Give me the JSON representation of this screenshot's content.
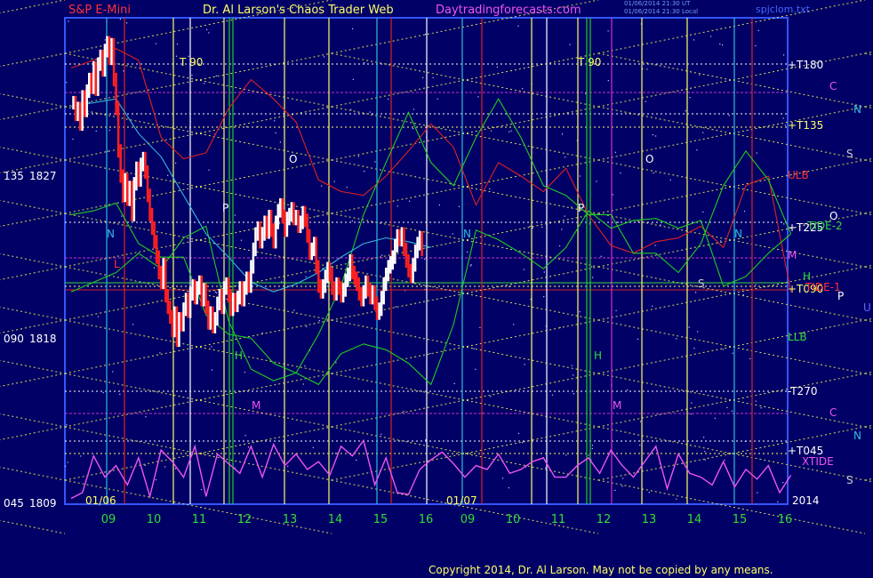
{
  "header": {
    "symbol": "S&P E-Mini",
    "author": "Dr. Al Larson's Chaos Trader Web",
    "site": "Daytradingforecasts.com",
    "stamp_line1": "01/06/2014 21:30 UT",
    "stamp_line2": "01/06/2014 21:30 Local",
    "file": "spjclom.txt"
  },
  "footer": {
    "copyright": "Copyright 2014, Dr. Al Larson. May not be copied by any means."
  },
  "colors": {
    "background": "#000066",
    "border": "#3355ff",
    "price_bar": "#ffffff",
    "price_down": "#ff2020",
    "red_line": "#dd2222",
    "green_line": "#22cc22",
    "cyan_line": "#33bbdd",
    "magenta_line": "#ee55ee",
    "yellow_dotted": "#dddd55"
  },
  "labels": {
    "t90_a": "T  90",
    "t90_b": "T  90",
    "date_a": "01/06",
    "date_b": "01/07",
    "year": "2014",
    "O_a": "O",
    "O_b": "O",
    "P_a": "P",
    "P_b": "P",
    "N_a": "N",
    "N_b": "N",
    "H_a": "H",
    "H_b": "H",
    "M_a": "M",
    "M_b": "M",
    "S_mid": "S",
    "L_mid": "L"
  },
  "right_labels": [
    {
      "text": "+T180",
      "color": "#ffffff"
    },
    {
      "text": "+T135",
      "color": "#ffff66"
    },
    {
      "text": "ULB",
      "color": "#ff3333"
    },
    {
      "text": "+T225",
      "color": "#ffffff"
    },
    {
      "text": "TIDE-2",
      "color": "#33dd33"
    },
    {
      "text": "M",
      "color": "#ee55ee"
    },
    {
      "text": "H",
      "color": "#33dd33"
    },
    {
      "text": "+T090",
      "color": "#ffff66"
    },
    {
      "text": "TIDE-1",
      "color": "#ff3333"
    },
    {
      "text": "LLB",
      "color": "#33dd33"
    },
    {
      "text": "-T270",
      "color": "#ffffff"
    },
    {
      "text": "+T045",
      "color": "#ffffff"
    },
    {
      "text": "XTIDE",
      "color": "#ee55ee"
    }
  ],
  "planet_labels": [
    {
      "text": "C",
      "color": "#ee55ee"
    },
    {
      "text": "N",
      "color": "#33bbdd"
    },
    {
      "text": "S",
      "color": "#cccccc"
    },
    {
      "text": "O",
      "color": "#ffffff"
    },
    {
      "text": "P",
      "color": "#ffffff"
    },
    {
      "text": "U",
      "color": "#6666ff"
    },
    {
      "text": "C",
      "color": "#ee55ee"
    },
    {
      "text": "N",
      "color": "#33bbdd"
    },
    {
      "text": "S",
      "color": "#cccccc"
    }
  ],
  "chart_data": {
    "type": "line",
    "title": "S&P E-Mini",
    "x_ticks": [
      "09",
      "10",
      "11",
      "12",
      "13",
      "14",
      "15",
      "16",
      "09",
      "10",
      "11",
      "12",
      "13",
      "14",
      "15",
      "16"
    ],
    "y_ticks": [
      {
        "angle": "135",
        "price": "1827"
      },
      {
        "angle": "090",
        "price": "1818"
      },
      {
        "angle": "045",
        "price": "1809"
      }
    ],
    "ylim": [
      1809,
      1834.2
    ],
    "price_series": {
      "name": "S&P E-Mini",
      "x": [
        0.05,
        0.1,
        0.15,
        0.2,
        0.25,
        0.3,
        0.35,
        0.4,
        0.45,
        0.5,
        0.55,
        0.6,
        0.65,
        0.7,
        0.75,
        0.8,
        0.85,
        0.9,
        0.95,
        1.0,
        1.05,
        1.1,
        1.15,
        1.2,
        1.25,
        1.3,
        1.35,
        1.4,
        1.45,
        1.5,
        1.55,
        1.6,
        1.65,
        1.7,
        1.75,
        1.8,
        1.85,
        1.9,
        1.95,
        2.0,
        2.05,
        2.1,
        2.15,
        2.2,
        2.25,
        2.3,
        2.35,
        2.4,
        2.45,
        2.5,
        2.55,
        2.6,
        2.65,
        2.7,
        2.75,
        2.8,
        2.85,
        2.9,
        2.95,
        3.0,
        3.05,
        3.1,
        3.15,
        3.2,
        3.25,
        3.3,
        3.35,
        3.4,
        3.45,
        3.5,
        3.55,
        3.6,
        3.65,
        3.7,
        3.75,
        3.8,
        3.85,
        3.9,
        3.95,
        4.0,
        4.05,
        4.1,
        4.15,
        4.2,
        4.25,
        4.3,
        4.35,
        4.4,
        4.45,
        4.5,
        4.55,
        4.6,
        4.65,
        4.7,
        4.75,
        4.8,
        4.85,
        4.9,
        4.95,
        5.0,
        5.05,
        5.1,
        5.15,
        5.2,
        5.25,
        5.3,
        5.35,
        5.4,
        5.45,
        5.5,
        5.55,
        5.6,
        5.65,
        5.7,
        5.75,
        5.8,
        5.85,
        5.9,
        5.95,
        6.0,
        6.05,
        6.1,
        6.15,
        6.2,
        6.25,
        6.3,
        6.35,
        6.4,
        6.45,
        6.5,
        6.55,
        6.6,
        6.65,
        6.7,
        6.75,
        6.8,
        6.85,
        6.9,
        6.95,
        7.0,
        7.05,
        7.1,
        7.15,
        7.2,
        7.25,
        7.3,
        7.35,
        7.4,
        7.45,
        7.5,
        7.55,
        7.6,
        7.65,
        7.7,
        7.75,
        7.8,
        7.85,
        7.9
      ],
      "y": [
        1829.8,
        1829.2,
        1829.5,
        1828.7,
        1830.1,
        1829.4,
        1830.4,
        1831.0,
        1830.6,
        1831.6,
        1830.5,
        1831.8,
        1832.2,
        1831.5,
        1832.5,
        1832.9,
        1832.1,
        1832.8,
        1831.0,
        1829.5,
        1827.3,
        1826.0,
        1825.0,
        1825.8,
        1824.8,
        1825.4,
        1824.0,
        1825.6,
        1826.4,
        1825.8,
        1826.6,
        1826.9,
        1826.2,
        1825.0,
        1824.0,
        1823.3,
        1822.6,
        1821.8,
        1821.0,
        1820.5,
        1821.4,
        1819.8,
        1819.2,
        1818.7,
        1818.0,
        1818.9,
        1817.5,
        1818.6,
        1818.3,
        1819.1,
        1819.6,
        1819.0,
        1819.9,
        1820.3,
        1819.7,
        1820.2,
        1820.5,
        1819.6,
        1820.1,
        1819.2,
        1818.4,
        1818.9,
        1818.2,
        1818.6,
        1819.4,
        1819.8,
        1819.2,
        1820.2,
        1820.4,
        1819.8,
        1819.1,
        1819.6,
        1819.3,
        1819.7,
        1820.2,
        1819.6,
        1820.2,
        1820.7,
        1820.3,
        1821.3,
        1822.2,
        1823.0,
        1823.3,
        1822.6,
        1823.0,
        1823.6,
        1823.1,
        1823.9,
        1823.2,
        1822.6,
        1823.6,
        1824.2,
        1824.5,
        1823.9,
        1823.2,
        1823.8,
        1824.0,
        1824.3,
        1823.8,
        1823.9,
        1823.4,
        1823.6,
        1824.1,
        1823.7,
        1822.9,
        1822.0,
        1822.2,
        1822.5,
        1821.3,
        1820.3,
        1820.0,
        1820.3,
        1820.8,
        1821.2,
        1820.9,
        1820.2,
        1819.9,
        1820.4,
        1820.2,
        1819.8,
        1820.1,
        1820.6,
        1820.9,
        1821.6,
        1821.0,
        1820.7,
        1820.4,
        1819.9,
        1819.6,
        1820.0,
        1820.5,
        1820.1,
        1819.7,
        1820.0,
        1819.4,
        1818.9,
        1819.1,
        1819.7,
        1820.4,
        1820.9,
        1821.3,
        1821.5,
        1821.8,
        1822.4,
        1822.9,
        1822.7,
        1823.0,
        1822.2,
        1821.6,
        1821.1,
        1820.8,
        1821.4,
        1822.1,
        1822.5,
        1822.8,
        1822.2
      ],
      "note": "data"
    },
    "series": [
      {
        "name": "ULB",
        "color": "#dd2222",
        "x": [
          0,
          0.5,
          1,
          1.5,
          2,
          2.5,
          3,
          3.5,
          4,
          4.5,
          5,
          5.5,
          6,
          6.5,
          7,
          7.5,
          8,
          8.5,
          9,
          9.5,
          10,
          10.5,
          11,
          11.5,
          12,
          12.5,
          13,
          13.5,
          14,
          14.5,
          15,
          15.5,
          16
        ],
        "y": [
          1831.6,
          1832.0,
          1832.6,
          1832.0,
          1828.0,
          1826.9,
          1827.2,
          1829.5,
          1831.0,
          1830.0,
          1828.8,
          1825.8,
          1825.2,
          1825.0,
          1826.0,
          1827.3,
          1828.7,
          1827.5,
          1824.5,
          1826.7,
          1826.0,
          1825.2,
          1826.4,
          1824.0,
          1822.4,
          1822.0,
          1822.6,
          1822.8,
          1823.4,
          1822.3,
          1825.5,
          1826.0,
          1820.0
        ]
      },
      {
        "name": "LLB",
        "color": "#22cc22",
        "x": [
          0,
          0.5,
          1,
          1.5,
          2,
          2.5,
          3,
          3.5,
          4,
          4.5,
          5,
          5.5,
          6,
          6.5,
          7,
          7.5,
          8,
          8.5,
          9,
          9.5,
          10,
          10.5,
          11,
          11.5,
          12,
          12.5,
          13,
          13.5,
          14,
          14.5,
          15,
          15.5,
          16
        ],
        "y": [
          1820.0,
          1820.5,
          1821.0,
          1822.0,
          1821.2,
          1822.8,
          1823.4,
          1818.5,
          1816.0,
          1815.4,
          1815.8,
          1817.8,
          1820.3,
          1824.0,
          1826.7,
          1829.3,
          1826.7,
          1825.5,
          1828.0,
          1830.0,
          1828.0,
          1825.5,
          1825.0,
          1824.0,
          1824.0,
          1822.0,
          1822.0,
          1821.0,
          1822.5,
          1825.5,
          1827.3,
          1825.8,
          1823.0
        ]
      },
      {
        "name": "TIDE-2",
        "color": "#22cc22",
        "x": [
          0,
          0.5,
          1,
          1.5,
          2,
          2.5,
          3,
          3.5,
          4,
          4.5,
          5,
          5.5,
          6,
          6.5,
          7,
          7.5,
          8,
          8.5,
          9,
          9.5,
          10,
          10.5,
          11,
          11.5,
          12,
          12.5,
          13,
          13.5,
          14,
          14.5,
          15,
          15.5,
          16
        ],
        "y": [
          1824.0,
          1824.2,
          1824.6,
          1822.5,
          1821.8,
          1821.8,
          1818.8,
          1817.8,
          1817.6,
          1816.3,
          1815.8,
          1815.2,
          1816.8,
          1817.3,
          1817.0,
          1816.3,
          1815.2,
          1818.3,
          1823.2,
          1822.7,
          1822.0,
          1821.2,
          1822.3,
          1824.2,
          1823.3,
          1823.7,
          1823.8,
          1823.3,
          1823.7,
          1820.3,
          1820.8,
          1822.0,
          1823.0
        ]
      },
      {
        "name": "Cyan",
        "color": "#33bbdd",
        "x": [
          0,
          0.5,
          1,
          1.5,
          2,
          2.5,
          3,
          3.5,
          4,
          4.5,
          5,
          5.5,
          6,
          6.5,
          7,
          7.5,
          8
        ],
        "y": [
          1829.6,
          1829.8,
          1830.0,
          1828.2,
          1827.0,
          1825.0,
          1823.0,
          1821.8,
          1820.5,
          1820.0,
          1820.4,
          1821.0,
          1821.8,
          1822.5,
          1822.8,
          1822.6,
          1822.3
        ]
      },
      {
        "name": "XTIDE",
        "color": "#ee55ee",
        "x": [
          0,
          0.25,
          0.5,
          0.75,
          1,
          1.25,
          1.5,
          1.75,
          2,
          2.25,
          2.5,
          2.75,
          3,
          3.25,
          3.5,
          3.75,
          4,
          4.25,
          4.5,
          4.75,
          5,
          5.25,
          5.5,
          5.75,
          6,
          6.25,
          6.5,
          6.75,
          7,
          7.25,
          7.5,
          7.75,
          8,
          8.25,
          8.5,
          8.75,
          9,
          9.25,
          9.5,
          9.75,
          10,
          10.25,
          10.5,
          10.75,
          11,
          11.25,
          11.5,
          11.75,
          12,
          12.25,
          12.5,
          12.75,
          13,
          13.25,
          13.5,
          13.75,
          14,
          14.25,
          14.5,
          14.75,
          15,
          15.25,
          15.5,
          15.75,
          16
        ],
        "y": [
          1809.3,
          1809.6,
          1811.5,
          1810.4,
          1811.0,
          1810.0,
          1811.4,
          1809.4,
          1811.8,
          1811.2,
          1810.4,
          1812.0,
          1809.4,
          1811.6,
          1811.1,
          1810.6,
          1812.0,
          1810.4,
          1812.1,
          1811.0,
          1811.6,
          1810.8,
          1811.2,
          1810.5,
          1812.0,
          1811.5,
          1812.3,
          1810.0,
          1811.4,
          1809.6,
          1809.5,
          1810.8,
          1811.3,
          1811.7,
          1811.1,
          1810.4,
          1811.0,
          1810.8,
          1811.6,
          1810.6,
          1810.8,
          1811.2,
          1811.4,
          1810.4,
          1810.4,
          1811.0,
          1811.4,
          1810.6,
          1811.8,
          1811.0,
          1810.4,
          1811.2,
          1812.0,
          1809.8,
          1811.6,
          1810.6,
          1810.4,
          1810.0,
          1811.2,
          1809.9,
          1810.8,
          1810.3,
          1811.0,
          1809.6,
          1810.5
        ]
      }
    ]
  }
}
